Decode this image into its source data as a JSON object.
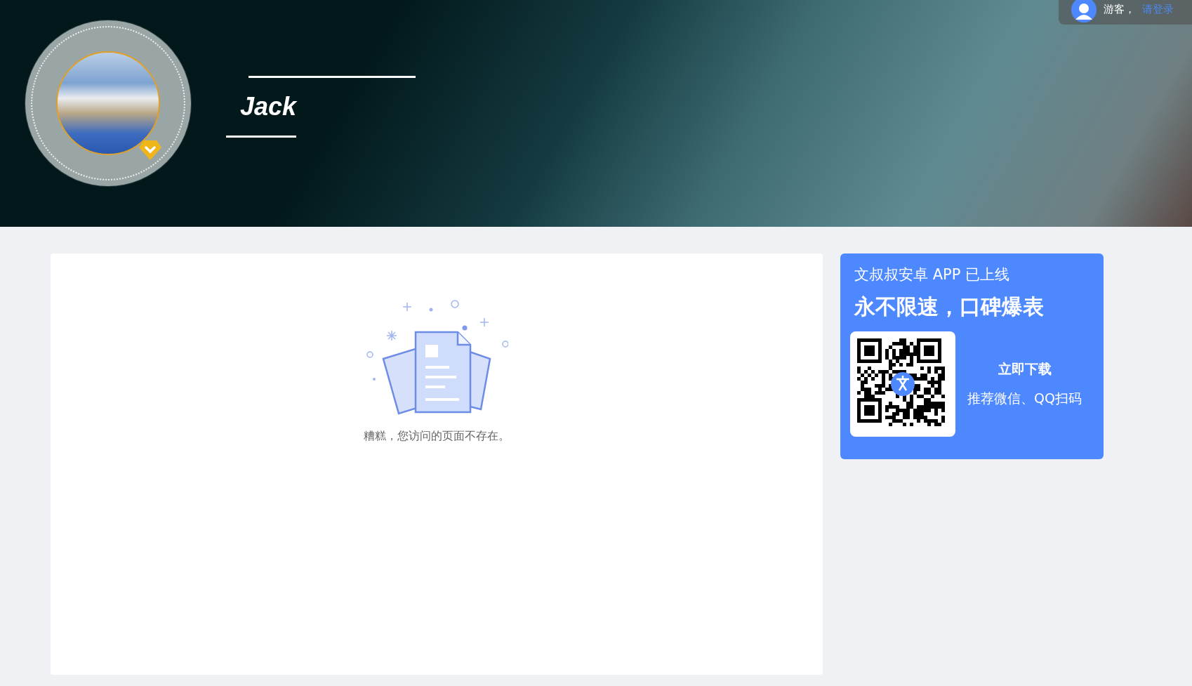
{
  "user_bar": {
    "greeting": "游客，",
    "login_link": "请登录"
  },
  "profile": {
    "name": "Jack",
    "verified": true
  },
  "empty_state": {
    "message": "糟糕，您访问的页面不存在。"
  },
  "app_promo": {
    "title": "文叔叔安卓 APP 已上线",
    "slogan": "永不限速，口碑爆表",
    "download": "立即下载",
    "hint": "推荐微信、QQ扫码"
  }
}
